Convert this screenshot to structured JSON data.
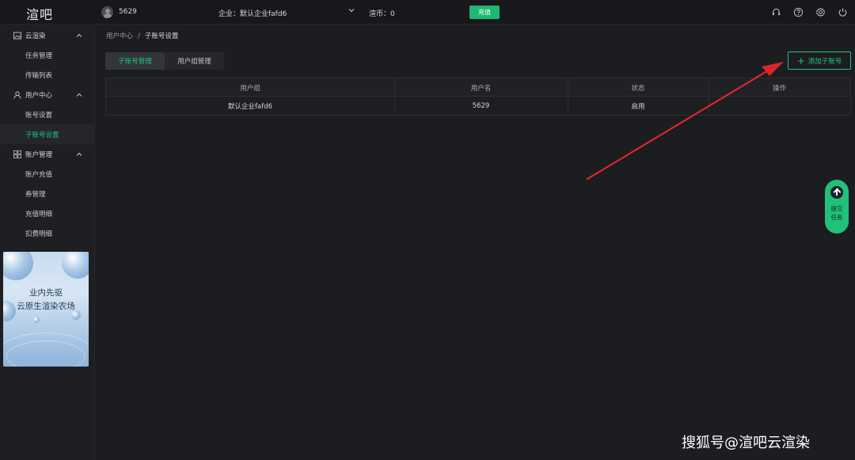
{
  "header": {
    "logo": "渲吧",
    "user_id": "5629",
    "company": "企业：默认企业fafd6",
    "coins": "渲币：0",
    "recharge_label": "充值",
    "icons": [
      "headset-icon",
      "help-icon",
      "settings-icon",
      "power-icon"
    ]
  },
  "sidebar": {
    "groups": [
      {
        "label": "云渲染",
        "icon": "image-icon",
        "items": [
          "任务管理",
          "传输列表"
        ]
      },
      {
        "label": "用户中心",
        "icon": "user-icon",
        "items": [
          "账号设置",
          "子账号设置"
        ]
      },
      {
        "label": "账户管理",
        "icon": "grid-icon",
        "items": [
          "账户充值",
          "券管理",
          "充值明细",
          "扣费明细"
        ]
      }
    ],
    "active_item": "子账号设置",
    "promo": {
      "line1": "业内先驱",
      "line2": "云原生渲染农场"
    }
  },
  "breadcrumb": {
    "parent": "用户中心",
    "separator": "/",
    "current": "子账号设置"
  },
  "tabs": [
    {
      "label": "子账号管理",
      "active": true
    },
    {
      "label": "用户组管理",
      "active": false
    }
  ],
  "add_button_label": "添加子账号",
  "table": {
    "columns": [
      "用户组",
      "用户名",
      "状态",
      "操作"
    ],
    "rows": [
      [
        "默认企业fafd6",
        "5629",
        "启用",
        ""
      ]
    ]
  },
  "float_button": {
    "line1": "提交",
    "line2": "任务"
  },
  "watermark": "搜狐号@渲吧云渲染",
  "colors": {
    "accent": "#21c17a",
    "background": "#1c1d21",
    "annotation_arrow": "#d9262c"
  }
}
